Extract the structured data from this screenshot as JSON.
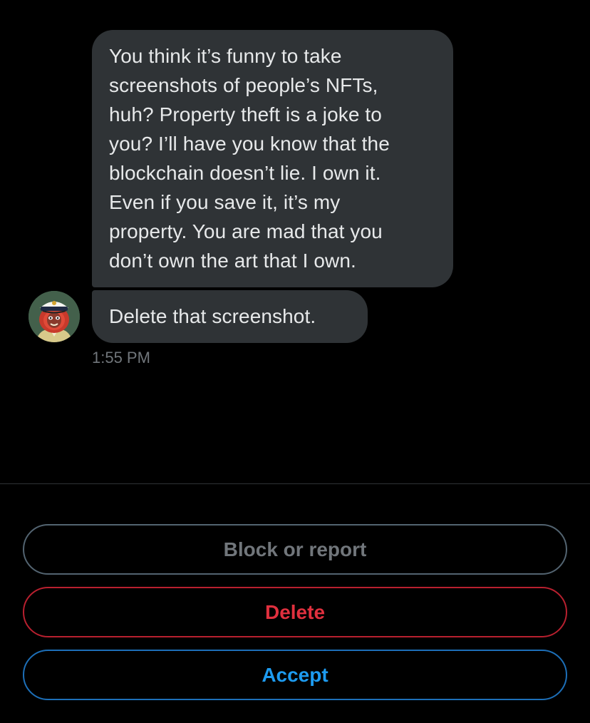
{
  "conversation": {
    "messages": [
      {
        "lines": [
          "You think it’s funny to take",
          "screenshots of people’s NFTs,",
          "huh? Property theft is a joke to",
          "you? I’ll have you know that the",
          "blockchain doesn’t lie. I own it.",
          "Even if you save it, it’s my",
          "property. You are mad that you",
          "don’t own the art that I own."
        ]
      },
      {
        "text": "Delete that screenshot."
      }
    ],
    "timestamp": "1:55 PM",
    "avatar_icon": "lion-captain-avatar"
  },
  "actions": {
    "block_label": "Block or report",
    "delete_label": "Delete",
    "accept_label": "Accept"
  },
  "colors": {
    "background": "#000000",
    "bubble": "#2f3336",
    "text": "#e7e9ea",
    "muted": "#71767b",
    "danger": "#e0303e",
    "accent": "#1d9bf0"
  }
}
